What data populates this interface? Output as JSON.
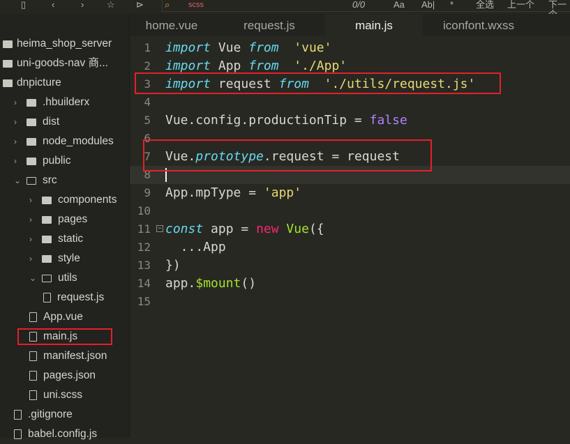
{
  "toolbar": {
    "search_value": "scss",
    "match_count": "0/0",
    "case_btn": "Aa",
    "word_btn": "Ab|",
    "select_all": "全选",
    "prev": "上一个",
    "next": "下一个"
  },
  "tabs": [
    {
      "label": "home.vue"
    },
    {
      "label": "request.js"
    },
    {
      "label": "main.js",
      "active": true
    },
    {
      "label": "iconfont.wxss"
    }
  ],
  "sidebar": {
    "items": [
      "heima_shop_server",
      "uni-goods-nav 商...",
      "dnpicture",
      ".hbuilderx",
      "dist",
      "node_modules",
      "public",
      "src",
      "components",
      "pages",
      "static",
      "style",
      "utils",
      "request.js",
      "App.vue",
      "main.js",
      "manifest.json",
      "pages.json",
      "uni.scss",
      ".gitignore",
      "babel.config.js"
    ],
    "selected": "main.js"
  },
  "editor": {
    "line_numbers": [
      "1",
      "2",
      "3",
      "4",
      "5",
      "6",
      "7",
      "8",
      "9",
      "10",
      "11",
      "12",
      "13",
      "14",
      "15"
    ],
    "lines": [
      [
        [
          "kw",
          "import"
        ],
        [
          "",
          "Vue "
        ],
        [
          "kw",
          "from"
        ],
        [
          "str",
          " 'vue'"
        ]
      ],
      [
        [
          "kw",
          "import"
        ],
        [
          "",
          "App "
        ],
        [
          "kw",
          "from"
        ],
        [
          "str",
          " './App'"
        ]
      ],
      [
        [
          "kw",
          "import"
        ],
        [
          "",
          "request "
        ],
        [
          "kw",
          "from"
        ],
        [
          "str",
          " './utils/request.js'"
        ]
      ],
      [],
      [
        [
          "",
          "Vue.config.productionTip = "
        ],
        [
          "bool",
          "false"
        ]
      ],
      [],
      [
        [
          "",
          "Vue."
        ],
        [
          "it",
          "prototype"
        ],
        [
          "",
          ".request = request"
        ]
      ],
      [],
      [
        [
          "",
          "App.mpType = "
        ],
        [
          "str",
          "'app'"
        ]
      ],
      [],
      [
        [
          "kw",
          "const"
        ],
        [
          "",
          "app = "
        ],
        [
          "new",
          "new"
        ],
        [
          "fn",
          " Vue"
        ],
        [
          "",
          "({"
        ]
      ],
      [
        [
          "",
          "  ...App"
        ]
      ],
      [
        [
          "",
          "})"
        ]
      ],
      [
        [
          "",
          "app."
        ],
        [
          "fn",
          "$mount"
        ],
        [
          "",
          "()"
        ]
      ],
      []
    ]
  },
  "colors": {
    "highlight_box": "#e5202a",
    "background": "#272822"
  }
}
